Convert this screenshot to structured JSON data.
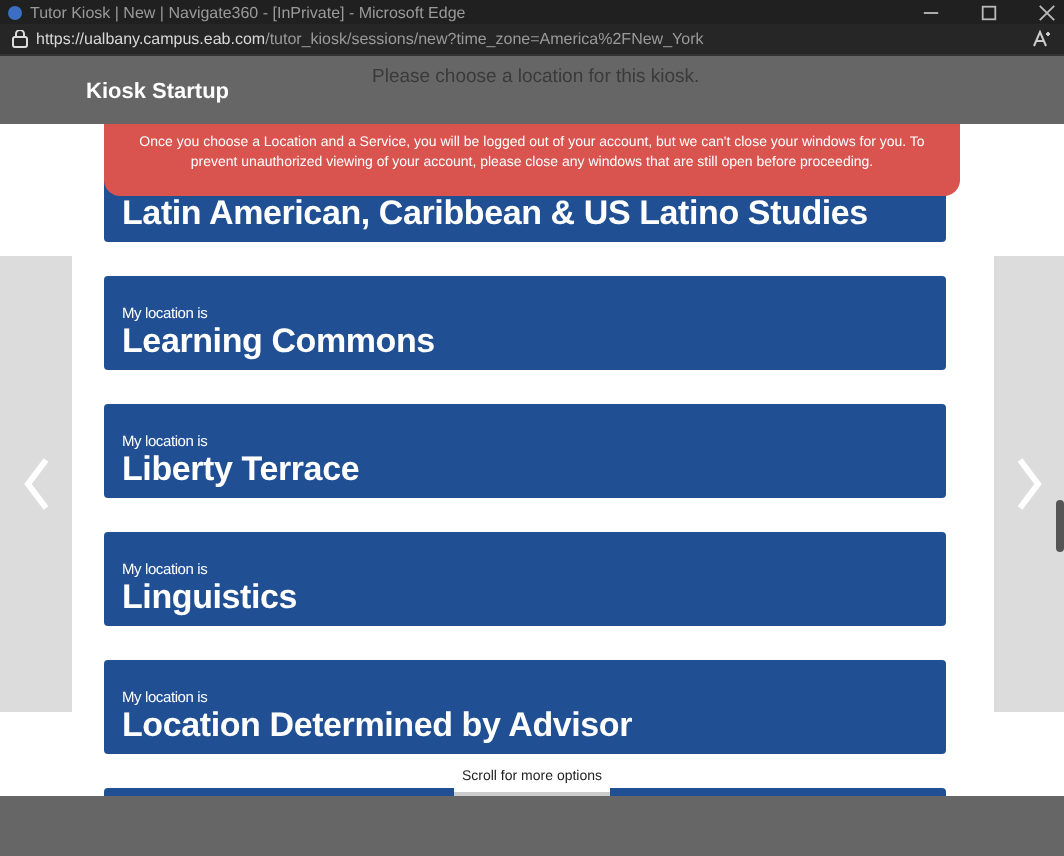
{
  "window": {
    "title": "Tutor Kiosk | New | Navigate360 - [InPrivate] - Microsoft Edge"
  },
  "address_bar": {
    "host": "https://ualbany.campus.eab.com",
    "path": "/tutor_kiosk/sessions/new?time_zone=America%2FNew_York"
  },
  "header": {
    "title": "Kiosk Startup",
    "prompt": "Please choose a location for this kiosk."
  },
  "alert": {
    "text": "Once you choose a Location and a Service, you will be logged out of your account, but we can't close your windows for you. To prevent unauthorized viewing of your account, please close any windows that are still open before proceeding."
  },
  "locations": [
    {
      "name": "Latin American, Caribbean & US Latino Studies"
    },
    {
      "label": "My location is",
      "name": "Learning Commons"
    },
    {
      "label": "My location is",
      "name": "Liberty Terrace"
    },
    {
      "label": "My location is",
      "name": "Linguistics"
    },
    {
      "label": "My location is",
      "name": "Location Determined by Advisor"
    }
  ],
  "scroll_hint": "Scroll for more options"
}
